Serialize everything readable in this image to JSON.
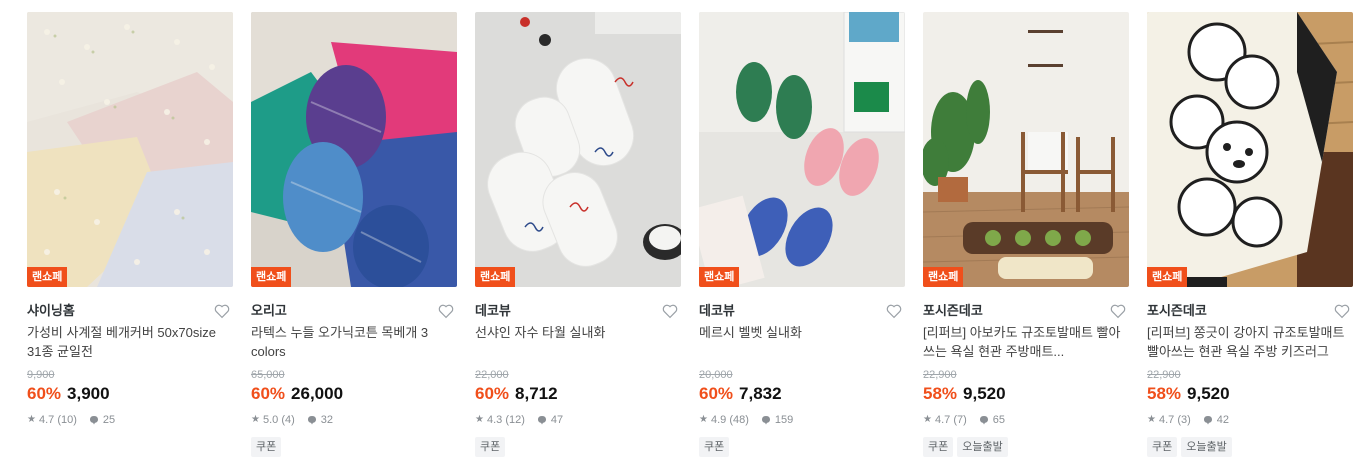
{
  "products": [
    {
      "badge": "랜쇼페",
      "brand": "샤이닝홈",
      "title": "가성비 사계절 베개커버 50x70size 31종 균일전",
      "original_price": "9,900",
      "discount": "60%",
      "price": "3,900",
      "rating": "4.7 (10)",
      "reviews": "25",
      "tags": []
    },
    {
      "badge": "랜쇼페",
      "brand": "오리고",
      "title": "라텍스 누들 오가닉코튼 목베개 3 colors",
      "original_price": "65,000",
      "discount": "60%",
      "price": "26,000",
      "rating": "5.0 (4)",
      "reviews": "32",
      "tags": [
        "쿠폰"
      ]
    },
    {
      "badge": "랜쇼페",
      "brand": "데코뷰",
      "title": "선샤인 자수 타월 실내화",
      "original_price": "22,000",
      "discount": "60%",
      "price": "8,712",
      "rating": "4.3 (12)",
      "reviews": "47",
      "tags": [
        "쿠폰"
      ]
    },
    {
      "badge": "랜쇼페",
      "brand": "데코뷰",
      "title": "메르시 벨벳 실내화",
      "original_price": "20,000",
      "discount": "60%",
      "price": "7,832",
      "rating": "4.9 (48)",
      "reviews": "159",
      "tags": [
        "쿠폰"
      ]
    },
    {
      "badge": "랜쇼페",
      "brand": "포시즌데코",
      "title": "[리퍼브] 아보카도 규조토발매트 빨아쓰는 욕실 현관 주방매트...",
      "original_price": "22,900",
      "discount": "58%",
      "price": "9,520",
      "rating": "4.7 (7)",
      "reviews": "65",
      "tags": [
        "쿠폰",
        "오늘출발"
      ]
    },
    {
      "badge": "랜쇼페",
      "brand": "포시즌데코",
      "title": "[리퍼브] 쫑긋이 강아지 규조토발매트 빨아쓰는 현관 욕실 주방 키즈러그",
      "original_price": "22,900",
      "discount": "58%",
      "price": "9,520",
      "rating": "4.7 (3)",
      "reviews": "42",
      "tags": [
        "쿠폰",
        "오늘출발"
      ]
    }
  ],
  "colors": {
    "accent": "#f04f1b",
    "text": "#2f3438",
    "muted": "#a0a6ab"
  },
  "icons": {
    "wishlist": "heart-outline-icon",
    "rating": "star-icon",
    "review": "speech-bubble-icon"
  }
}
